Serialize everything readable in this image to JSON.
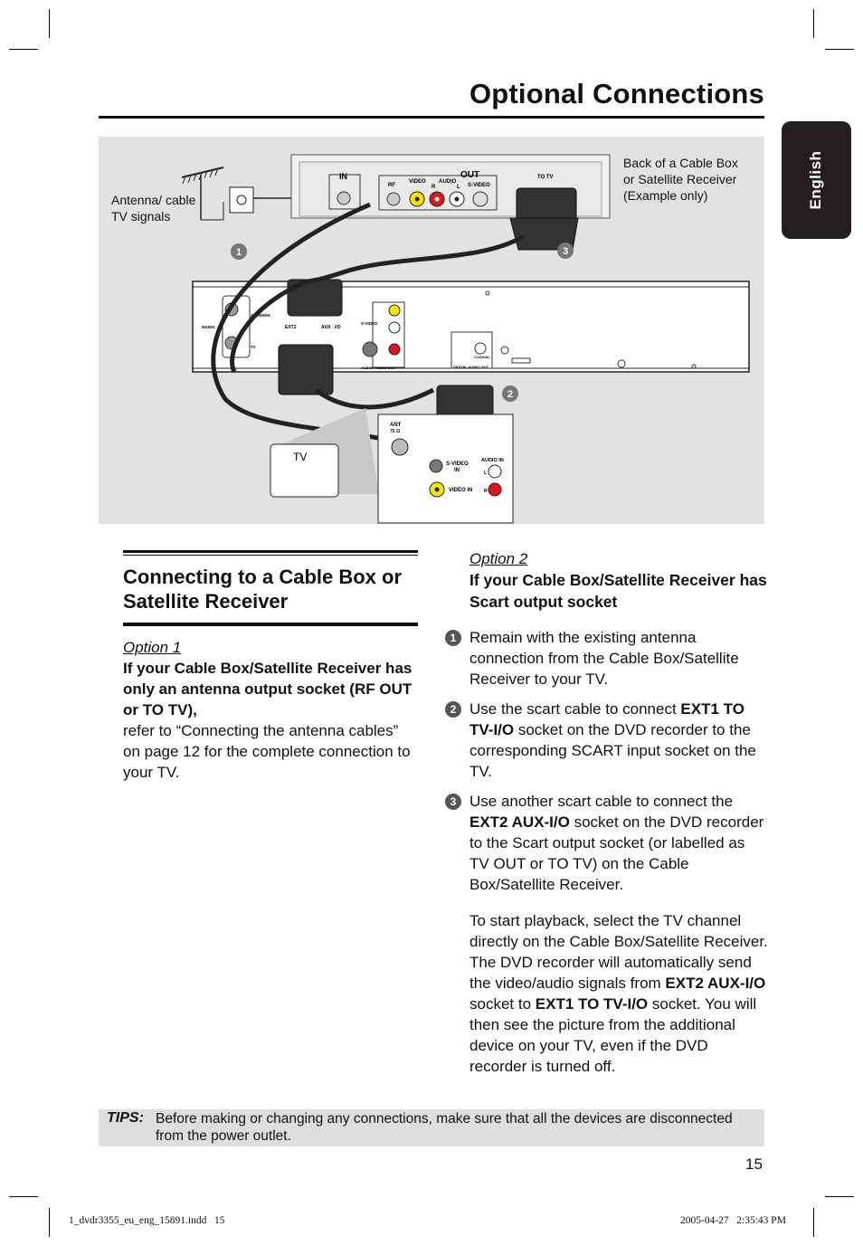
{
  "page": {
    "title": "Optional Connections",
    "side_tab": "English",
    "page_number": "15"
  },
  "diagram": {
    "antenna_label_1": "Antenna/ cable",
    "antenna_label_2": "TV signals",
    "cablebox_label_1": "Back of a Cable Box",
    "cablebox_label_2": "or Satellite Receiver",
    "cablebox_label_3": "(Example only)",
    "markers": [
      "1",
      "2",
      "3"
    ],
    "cablebox": {
      "in": "IN",
      "out": "OUT",
      "rf": "RF",
      "video": "VIDEO",
      "audio": "AUDIO",
      "r": "R",
      "l": "L",
      "svideo": "S-VIDEO",
      "to_tv": "TO TV"
    },
    "recorder": {
      "antenna": "ANTENNA",
      "tv": "TV",
      "mains": "MAINS",
      "ext2": "EXT2",
      "aux": "AUX - I/O",
      "svideo": "S-VIDEO",
      "av_out": "AUDIO / VIDEO OUT",
      "digital_out": "DIGITAL AUDIO OUT",
      "coaxial": "COAXIAL"
    },
    "tv": {
      "label": "TV",
      "ant": "ANT",
      "ohm": "75 Ω",
      "svideo_in_1": "S-VIDEO",
      "svideo_in_2": "IN",
      "video_in": "VIDEO IN",
      "audio_in": "AUDIO IN",
      "l": "L",
      "r": "R"
    },
    "colors": {
      "video": "#f5e400",
      "audio_r": "#e0161e",
      "background": "#e2e2e2"
    }
  },
  "left": {
    "heading": "Connecting to a Cable Box or Satellite Receiver",
    "option": "Option 1",
    "subheading": "If your Cable Box/Satellite Receiver has only an antenna output socket (RF OUT or TO TV),",
    "body": "refer to “Connecting the antenna cables” on page 12 for the complete connection to your TV."
  },
  "right": {
    "option": "Option 2",
    "subheading": "If your Cable Box/Satellite Receiver has Scart output socket",
    "steps": [
      {
        "num": "1",
        "text": "Remain with the existing antenna connection from the Cable Box/Satellite Receiver to your TV."
      },
      {
        "num": "2",
        "pre": "Use the scart cable to connect ",
        "bold": "EXT1 TO TV-I/O",
        "post": " socket on the DVD recorder to the corresponding SCART input socket on the TV."
      },
      {
        "num": "3",
        "pre": "Use another scart cable to connect the ",
        "bold": "EXT2 AUX-I/O",
        "post": " socket on the DVD recorder to the Scart output socket (or labelled as TV OUT or TO TV) on the Cable Box/Satellite Receiver."
      }
    ],
    "playback": {
      "a": "To start playback, select the TV channel directly on the Cable Box/Satellite Receiver. The DVD recorder will automatically send the video/audio signals from ",
      "b1": "EXT2 AUX-I/O",
      "c": " socket to ",
      "b2": "EXT1 TO TV-I/O",
      "d": " socket. You will then see the picture from the additional device on your TV, even if the DVD recorder is turned off."
    }
  },
  "tips": {
    "label": "TIPS:",
    "text": "Before making or changing any connections, make sure that all the devices are disconnected from the power outlet."
  },
  "footer": {
    "file": "1_dvdr3355_eu_eng_15891.indd   15",
    "timestamp": "2005-04-27   2:35:43 PM"
  }
}
